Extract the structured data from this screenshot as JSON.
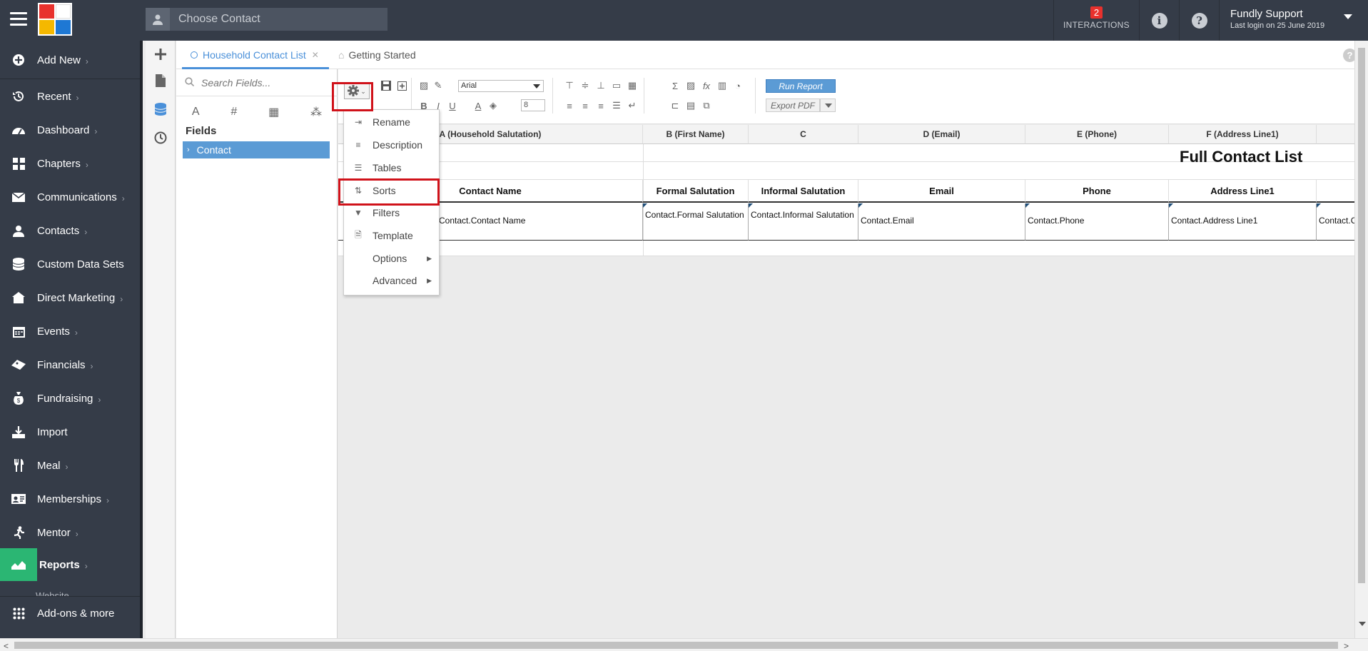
{
  "header": {
    "contact_search_placeholder": "Choose Contact",
    "interactions_count": "2",
    "interactions_label": "INTERACTIONS",
    "user_name": "Fundly Support",
    "last_login": "Last login on 25 June 2019"
  },
  "nav": {
    "items": [
      {
        "label": "Add New",
        "icon": "plus-circle-icon"
      },
      {
        "label": "Recent",
        "icon": "history-icon"
      },
      {
        "label": "Dashboard",
        "icon": "dashboard-icon"
      },
      {
        "label": "Chapters",
        "icon": "grid-icon"
      },
      {
        "label": "Communications",
        "icon": "envelope-icon"
      },
      {
        "label": "Contacts",
        "icon": "person-icon"
      },
      {
        "label": "Custom Data Sets",
        "icon": "database-icon"
      },
      {
        "label": "Direct Marketing",
        "icon": "house-icon"
      },
      {
        "label": "Events",
        "icon": "calendar-icon"
      },
      {
        "label": "Financials",
        "icon": "ticket-icon"
      },
      {
        "label": "Fundraising",
        "icon": "moneybag-icon"
      },
      {
        "label": "Import",
        "icon": "download-icon"
      },
      {
        "label": "Meal",
        "icon": "utensils-icon"
      },
      {
        "label": "Memberships",
        "icon": "id-card-icon"
      },
      {
        "label": "Mentor",
        "icon": "running-icon"
      },
      {
        "label": "Reports",
        "icon": "chart-icon"
      }
    ],
    "partial_item": "Website",
    "addons": "Add-ons & more",
    "active_color": "#2bb673"
  },
  "tabs": {
    "tab1": "Household Contact List",
    "tab2": "Getting Started"
  },
  "fields_panel": {
    "search_placeholder": "Search Fields...",
    "title": "Fields",
    "item": "Contact"
  },
  "toolbar": {
    "font": "Arial",
    "size": "8",
    "run_report": "Run Report",
    "export_pdf": "Export PDF"
  },
  "menu": {
    "items": [
      {
        "label": "Rename",
        "icon": "rename-icon"
      },
      {
        "label": "Description",
        "icon": "lines-icon"
      },
      {
        "label": "Tables",
        "icon": "table-icon"
      },
      {
        "label": "Sorts",
        "icon": "sort-icon"
      },
      {
        "label": "Filters",
        "icon": "filter-icon"
      },
      {
        "label": "Template",
        "icon": "file-icon"
      },
      {
        "label": "Options",
        "icon": ""
      },
      {
        "label": "Advanced",
        "icon": ""
      }
    ],
    "highlight_color": "#d0121a"
  },
  "grid": {
    "columns": [
      "A (Household Salutation)",
      "B (First Name)",
      "C",
      "D (Email)",
      "E (Phone)",
      "F (Address Line1)"
    ],
    "report_title": "Full Contact List",
    "headers": [
      "Contact Name",
      "Formal Salutation",
      "Informal Salutation",
      "Email",
      "Phone",
      "Address Line1"
    ],
    "row": [
      "Contact.Contact Name",
      "Contact.Formal Salutation",
      "Contact.Informal Salutation",
      "Contact.Email",
      "Contact.Phone",
      "Contact.Address Line1",
      "Contact.C"
    ]
  }
}
